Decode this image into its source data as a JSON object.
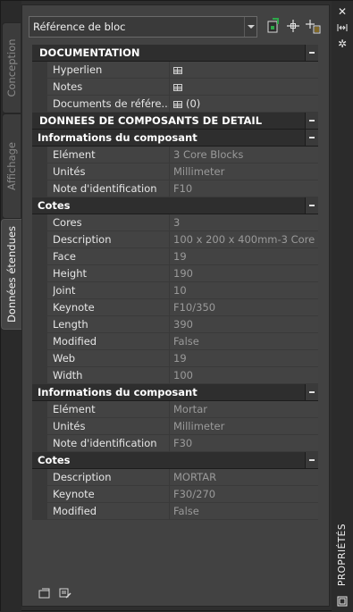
{
  "side_tabs": [
    {
      "label": "Conception"
    },
    {
      "label": "Affichage"
    },
    {
      "label": "Données étendues"
    }
  ],
  "toolbar": {
    "dropdown_value": "Référence de bloc"
  },
  "sections": {
    "documentation": {
      "title": "DOCUMENTATION",
      "rows": [
        {
          "name": "Hyperlien",
          "value": ""
        },
        {
          "name": "Notes",
          "value": ""
        },
        {
          "name": "Documents de référe...",
          "value": "(0)"
        }
      ]
    },
    "detail": {
      "title": "DONNEES DE COMPOSANTS DE DETAIL",
      "info1": {
        "title": "Informations du composant",
        "rows": [
          {
            "name": "Elément",
            "value": "3 Core Blocks"
          },
          {
            "name": "Unités",
            "value": "Millimeter"
          },
          {
            "name": "Note d'identification",
            "value": "F10"
          }
        ]
      },
      "cotes1": {
        "title": "Cotes",
        "rows": [
          {
            "name": "Cores",
            "value": "3"
          },
          {
            "name": "Description",
            "value": "100 x 200 x 400mm-3 Core"
          },
          {
            "name": "Face",
            "value": "19"
          },
          {
            "name": "Height",
            "value": "190"
          },
          {
            "name": "Joint",
            "value": "10"
          },
          {
            "name": "Keynote",
            "value": "F10/350"
          },
          {
            "name": "Length",
            "value": "390"
          },
          {
            "name": "Modified",
            "value": "False"
          },
          {
            "name": "Web",
            "value": "19"
          },
          {
            "name": "Width",
            "value": "100"
          }
        ]
      },
      "info2": {
        "title": "Informations du composant",
        "rows": [
          {
            "name": "Elément",
            "value": "Mortar"
          },
          {
            "name": "Unités",
            "value": "Millimeter"
          },
          {
            "name": "Note d'identification",
            "value": "F30"
          }
        ]
      },
      "cotes2": {
        "title": "Cotes",
        "rows": [
          {
            "name": "Description",
            "value": "MORTAR"
          },
          {
            "name": "Keynote",
            "value": "F30/270"
          },
          {
            "name": "Modified",
            "value": "False"
          }
        ]
      }
    }
  },
  "palette_title": "PROPRIÉTÉS",
  "colors": {
    "background": "#424242",
    "category": "#2e2e2e",
    "accent_green": "#2ea84a"
  }
}
